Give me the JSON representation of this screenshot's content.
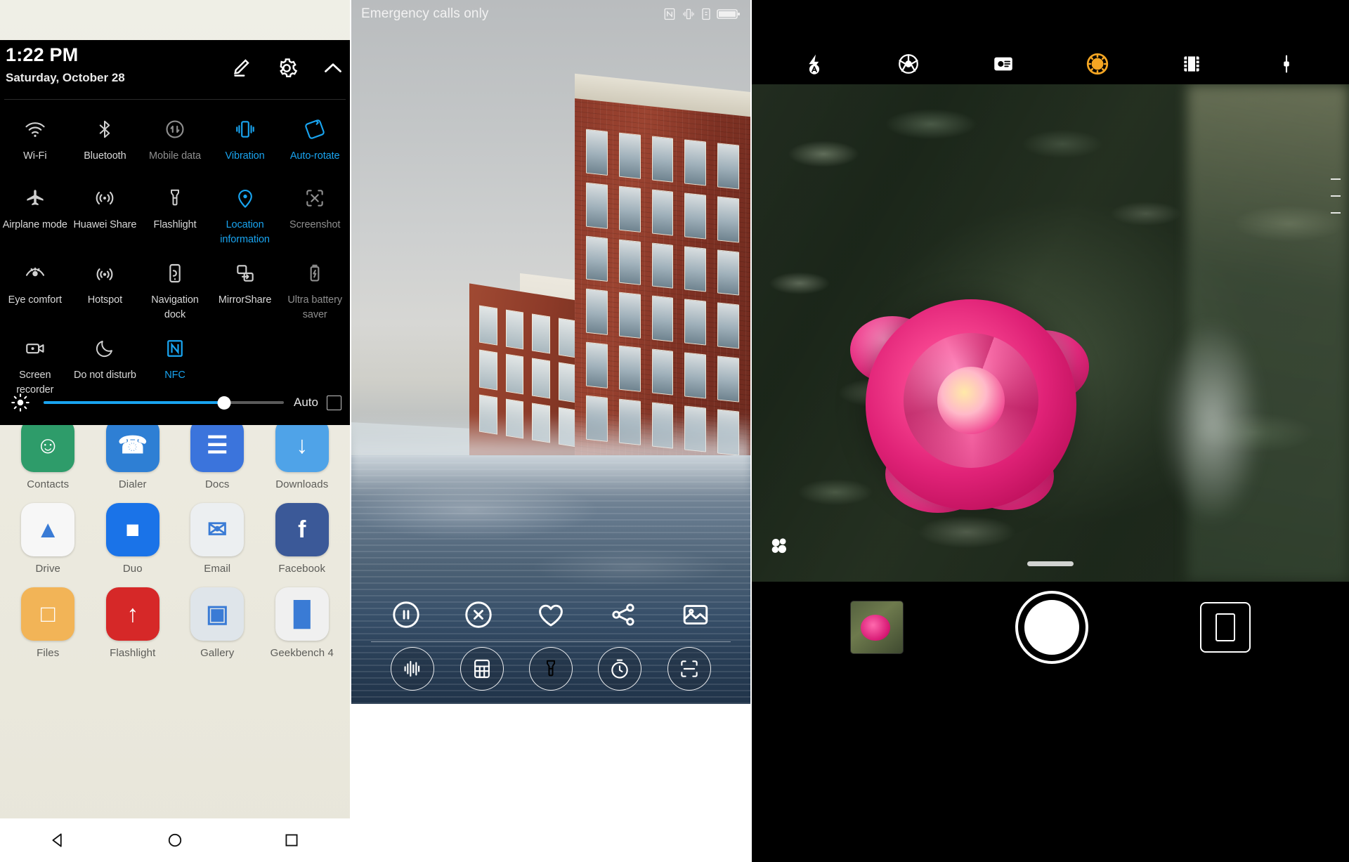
{
  "quick_settings": {
    "time": "1:22 PM",
    "date": "Saturday, October 28",
    "edit_icon": "pencil-icon",
    "settings_icon": "gear-icon",
    "collapse_icon": "chevron-up-icon",
    "accent_color": "#19a4f0",
    "toggles": [
      {
        "label": "Wi-Fi",
        "icon": "wifi-icon",
        "state": "off"
      },
      {
        "label": "Bluetooth",
        "icon": "bluetooth-icon",
        "state": "off"
      },
      {
        "label": "Mobile data",
        "icon": "mobile-data-icon",
        "state": "dim"
      },
      {
        "label": "Vibration",
        "icon": "vibration-icon",
        "state": "on"
      },
      {
        "label": "Auto-rotate",
        "icon": "auto-rotate-icon",
        "state": "on"
      },
      {
        "label": "Airplane mode",
        "icon": "airplane-icon",
        "state": "off"
      },
      {
        "label": "Huawei Share",
        "icon": "huawei-share-icon",
        "state": "off"
      },
      {
        "label": "Flashlight",
        "icon": "flashlight-icon",
        "state": "off"
      },
      {
        "label": "Location information",
        "icon": "location-pin-icon",
        "state": "on"
      },
      {
        "label": "Screenshot",
        "icon": "screenshot-icon",
        "state": "dim"
      },
      {
        "label": "Eye comfort",
        "icon": "eye-icon",
        "state": "off"
      },
      {
        "label": "Hotspot",
        "icon": "hotspot-icon",
        "state": "off"
      },
      {
        "label": "Navigation dock",
        "icon": "navigation-dock-icon",
        "state": "off"
      },
      {
        "label": "MirrorShare",
        "icon": "mirrorshare-icon",
        "state": "off"
      },
      {
        "label": "Ultra battery saver",
        "icon": "ultra-battery-saver-icon",
        "state": "dim"
      },
      {
        "label": "Screen recorder",
        "icon": "screen-recorder-icon",
        "state": "off"
      },
      {
        "label": "Do not disturb",
        "icon": "moon-icon",
        "state": "off"
      },
      {
        "label": "NFC",
        "icon": "nfc-icon",
        "state": "on"
      }
    ],
    "brightness": {
      "icon": "brightness-icon",
      "percent": 75,
      "auto_label": "Auto",
      "auto_checked": false
    },
    "app_drawer": [
      {
        "label": "Contacts",
        "color": "#2e9c6a",
        "glyph": "☺"
      },
      {
        "label": "Dialer",
        "color": "#2e7fd4",
        "glyph": "☎"
      },
      {
        "label": "Docs",
        "color": "#3b74dc",
        "glyph": "☰"
      },
      {
        "label": "Downloads",
        "color": "#4fa3e8",
        "glyph": "↓"
      },
      {
        "label": "Drive",
        "color": "#f7f7f7",
        "glyph": "▲"
      },
      {
        "label": "Duo",
        "color": "#1a73e8",
        "glyph": "■"
      },
      {
        "label": "Email",
        "color": "#eceff1",
        "glyph": "✉"
      },
      {
        "label": "Facebook",
        "color": "#3b5998",
        "glyph": "f"
      },
      {
        "label": "Files",
        "color": "#f2b457",
        "glyph": "□"
      },
      {
        "label": "Flashlight",
        "color": "#d62828",
        "glyph": "↑"
      },
      {
        "label": "Gallery",
        "color": "#dfe5ea",
        "glyph": "▣"
      },
      {
        "label": "Geekbench 4",
        "color": "#f0f0f0",
        "glyph": "█"
      }
    ]
  },
  "lock_screen": {
    "carrier": "Emergency calls only",
    "status_icons": [
      "nfc-icon",
      "vibrate-icon",
      "sim-icon",
      "battery-icon"
    ],
    "notification_actions": [
      {
        "icon": "pause-icon",
        "name": "pause-button"
      },
      {
        "icon": "close-circle-icon",
        "name": "dismiss-button"
      },
      {
        "icon": "heart-icon",
        "name": "favorite-button"
      },
      {
        "icon": "share-icon",
        "name": "share-button"
      },
      {
        "icon": "image-icon",
        "name": "wallpaper-button"
      }
    ],
    "shortcuts": [
      {
        "icon": "voice-recorder-icon",
        "name": "voice-recorder-shortcut"
      },
      {
        "icon": "calculator-icon",
        "name": "calculator-shortcut"
      },
      {
        "icon": "flashlight-icon",
        "name": "flashlight-shortcut"
      },
      {
        "icon": "stopwatch-icon",
        "name": "stopwatch-shortcut"
      },
      {
        "icon": "qr-scan-icon",
        "name": "scan-shortcut"
      }
    ]
  },
  "camera": {
    "top_controls": [
      {
        "icon": "flash-auto-icon",
        "name": "flash-mode-button"
      },
      {
        "icon": "aperture-icon",
        "name": "aperture-button"
      },
      {
        "icon": "portrait-icon",
        "name": "portrait-mode-button"
      },
      {
        "icon": "color-mode-icon",
        "name": "color-mode-button",
        "active": true
      },
      {
        "icon": "filter-icon",
        "name": "filter-button"
      },
      {
        "icon": "settings-slider-icon",
        "name": "camera-settings-button"
      }
    ],
    "accent_color": "#f5a623",
    "flower_icon": "macro-flower-icon",
    "bottom_controls": {
      "thumbnail": "last-photo-thumbnail",
      "shutter": "shutter-button",
      "mode": "camera-mode-button"
    }
  },
  "navigation": {
    "back": "back-triangle-icon",
    "home": "home-circle-icon",
    "recents": "recents-square-icon"
  }
}
